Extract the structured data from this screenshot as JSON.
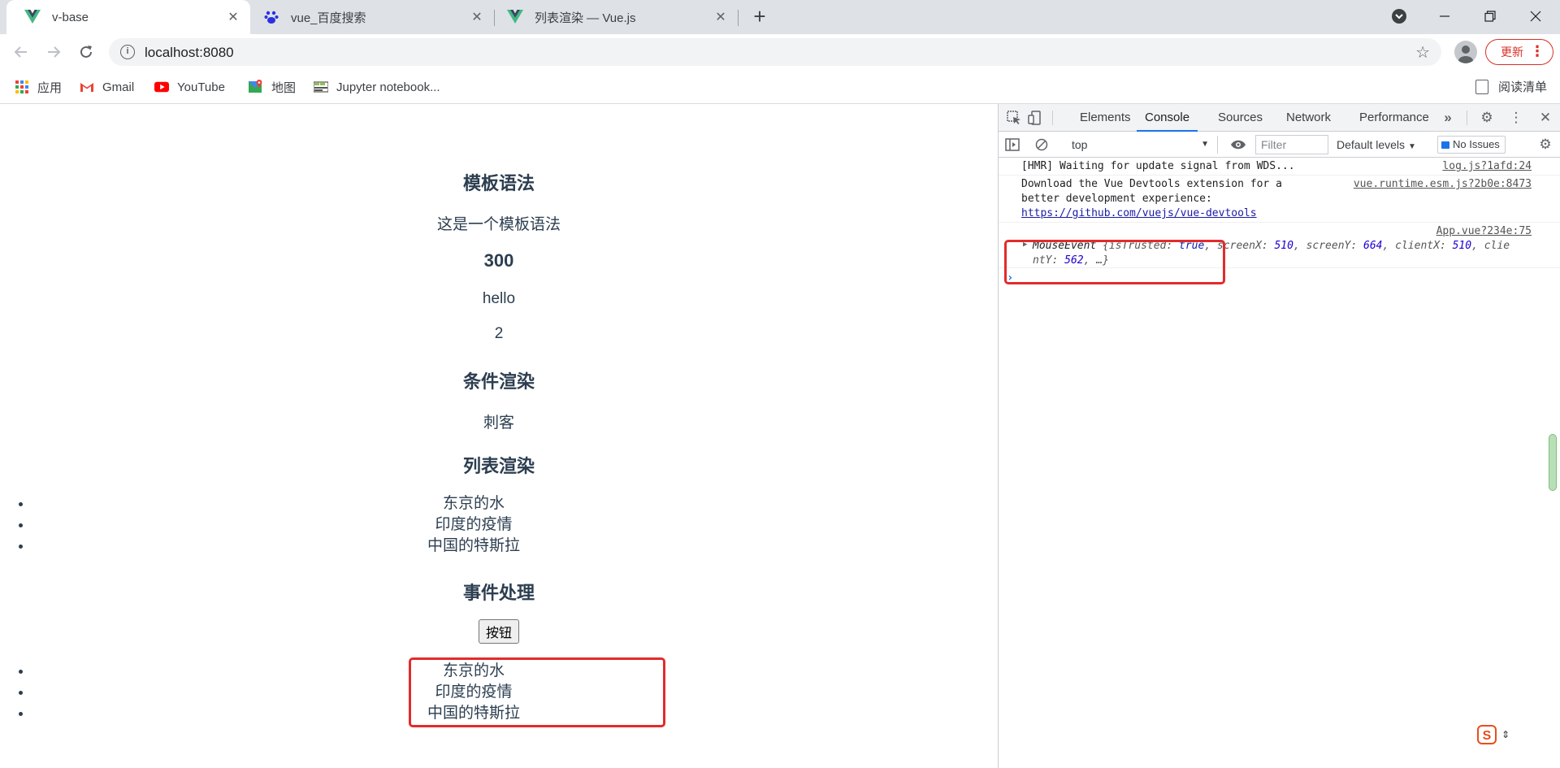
{
  "browser": {
    "tabs": [
      {
        "title": "v-base",
        "icon": "vue-logo-icon",
        "active": true
      },
      {
        "title": "vue_百度搜索",
        "icon": "baidu-paw-icon",
        "active": false
      },
      {
        "title": "列表渲染 — Vue.js",
        "icon": "vue-logo-icon",
        "active": false
      }
    ],
    "address": "localhost:8080",
    "update_label": "更新",
    "bookmarks": [
      {
        "label": "应用",
        "icon": "apps-grid-icon"
      },
      {
        "label": "Gmail",
        "icon": "gmail-icon"
      },
      {
        "label": "YouTube",
        "icon": "youtube-icon"
      },
      {
        "label": "地图",
        "icon": "maps-icon"
      },
      {
        "label": "Jupyter notebook...",
        "icon": "jupyter-icon"
      }
    ],
    "reading_list_label": "阅读清单"
  },
  "page": {
    "template_heading": "模板语法",
    "template_text": "这是一个模板语法",
    "number_value": "300",
    "hello_text": "hello",
    "count_value": "2",
    "conditional_heading": "条件渲染",
    "conditional_text": "刺客",
    "list_heading": "列表渲染",
    "list_items": [
      "东京的水",
      "印度的疫情",
      "中国的特斯拉"
    ],
    "event_heading": "事件处理",
    "button_label": "按钮",
    "event_list_items": [
      "东京的水",
      "印度的疫情",
      "中国的特斯拉"
    ]
  },
  "devtools": {
    "tabs": [
      "Elements",
      "Console",
      "Sources",
      "Network",
      "Performance"
    ],
    "active_tab": "Console",
    "context": "top",
    "filter_placeholder": "Filter",
    "levels_label": "Default levels",
    "issues_label": "No Issues",
    "console": [
      {
        "message": "[HMR] Waiting for update signal from WDS...",
        "source": "log.js?1afd:24"
      },
      {
        "message_line1": "Download the Vue Devtools extension for a",
        "message_line2": "better development experience:",
        "link": "https://github.com/vuejs/vue-devtools",
        "source": "vue.runtime.esm.js?2b0e:8473"
      },
      {
        "source": "App.vue?234e:75",
        "object_name": "MouseEvent",
        "isTrusted": "true",
        "screenX": "510",
        "screenY": "664",
        "clientX": "510",
        "clientY": "562"
      }
    ]
  },
  "colors": {
    "highlight_box": "#e32b2b",
    "vue_text": "#2c3e50",
    "devtools_accent": "#1a73e8",
    "update_red": "#d93025"
  }
}
